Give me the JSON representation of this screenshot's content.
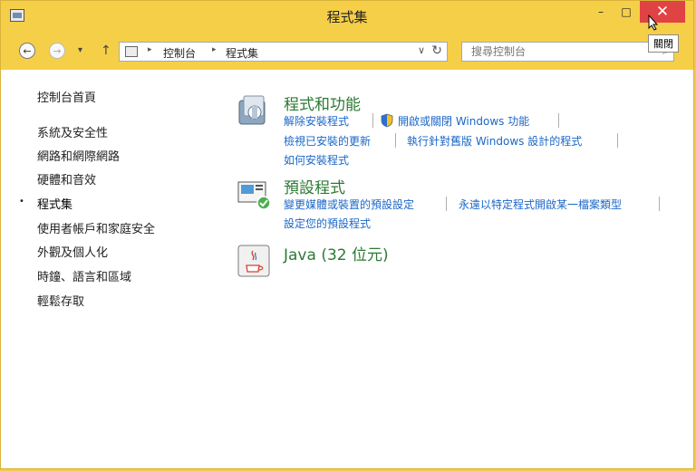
{
  "window": {
    "title": "程式集",
    "tooltip_close": "關閉",
    "min_glyph": "–",
    "max_glyph": "□",
    "close_glyph": "✕"
  },
  "toolbar": {
    "back_glyph": "←",
    "forward_glyph": "→",
    "history_glyph": "▾",
    "up_glyph": "↑",
    "breadcrumb": [
      "控制台",
      "程式集"
    ],
    "crumb_separator": "▸",
    "dropdown_glyph": "∨",
    "refresh_glyph": "↻",
    "search_placeholder": "搜尋控制台",
    "search_glyph": "⌕"
  },
  "sidebar": {
    "items": [
      {
        "label": "控制台首頁",
        "current": false
      },
      {
        "label": "系統及安全性",
        "current": false
      },
      {
        "label": "網路和網際網路",
        "current": false
      },
      {
        "label": "硬體和音效",
        "current": false
      },
      {
        "label": "程式集",
        "current": true
      },
      {
        "label": "使用者帳戶和家庭安全",
        "current": false
      },
      {
        "label": "外觀及個人化",
        "current": false
      },
      {
        "label": "時鐘、語言和區域",
        "current": false
      },
      {
        "label": "輕鬆存取",
        "current": false
      }
    ],
    "bullet": "•"
  },
  "groups": [
    {
      "title": "程式和功能",
      "icon": "programs-features-icon",
      "links": [
        "解除安裝程式",
        "開啟或關閉 Windows 功能",
        "檢視已安裝的更新",
        "執行針對舊版 Windows 設計的程式",
        "如何安裝程式"
      ]
    },
    {
      "title": "預設程式",
      "icon": "default-programs-icon",
      "links": [
        "變更媒體或裝置的預設設定",
        "永遠以特定程式開啟某一檔案類型",
        "設定您的預設程式"
      ]
    },
    {
      "title": "Java (32 位元)",
      "icon": "java-icon",
      "links": []
    }
  ],
  "colors": {
    "accent_title": "#f6cf49",
    "close_red": "#e04343",
    "link_blue": "#1b67c8",
    "group_green": "#2c7a34"
  }
}
